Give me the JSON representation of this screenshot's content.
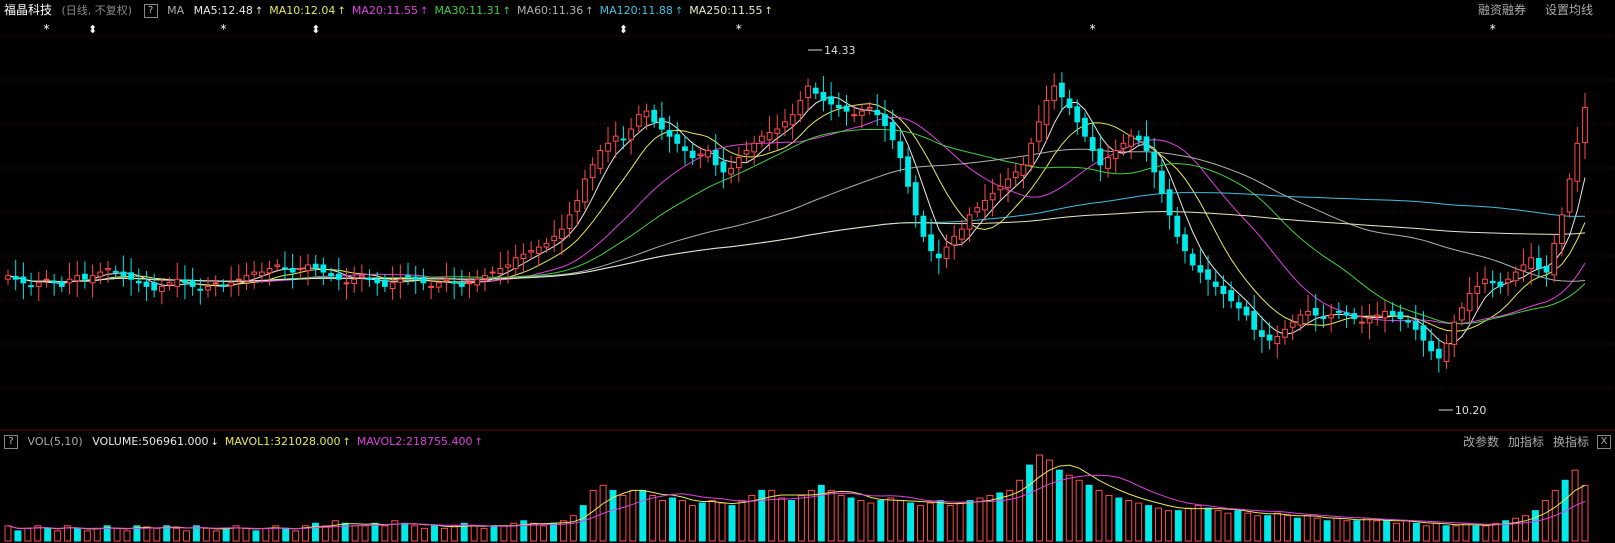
{
  "header": {
    "stock_name": "福晶科技",
    "period_label": "(日线, 不复权)",
    "help_label": "?",
    "indicator_name": "MA",
    "ma_items": [
      {
        "label": "MA5:12.48",
        "color": "#e8e8e8",
        "arrow": "↑"
      },
      {
        "label": "MA10:12.04",
        "color": "#e8e85a",
        "arrow": "↑"
      },
      {
        "label": "MA20:11.55",
        "color": "#e040e0",
        "arrow": "↑"
      },
      {
        "label": "MA30:11.31",
        "color": "#40d040",
        "arrow": "↑"
      },
      {
        "label": "MA60:11.36",
        "color": "#b0b0b0",
        "arrow": "↑"
      },
      {
        "label": "MA120:11.88",
        "color": "#40c0e0",
        "arrow": "↑"
      },
      {
        "label": "MA250:11.55",
        "color": "#e8e8c0",
        "arrow": "↑"
      }
    ],
    "right_buttons": [
      "融资融券",
      "设置均线"
    ]
  },
  "volume_header": {
    "help_label": "?",
    "indicator_name": "VOL(5,10)",
    "items": [
      {
        "label": "VOLUME:506961.000",
        "color": "#e8e8e8",
        "arrow": "↓"
      },
      {
        "label": "MAVOL1:321028.000",
        "color": "#e8e85a",
        "arrow": "↑"
      },
      {
        "label": "MAVOL2:218755.400",
        "color": "#e040e0",
        "arrow": "↑"
      }
    ],
    "right_buttons": [
      "改参数",
      "加指标",
      "换指标"
    ],
    "close_label": "X"
  },
  "colors": {
    "up": "#ff4a4a",
    "down": "#00e8e8",
    "grid": "#5a0a0a"
  },
  "chart_data": {
    "type": "candlestick",
    "price_range": [
      9.6,
      14.8
    ],
    "annotations": [
      {
        "label": "14.33",
        "type": "high"
      },
      {
        "label": "10.20",
        "type": "low"
      }
    ],
    "markers": {
      "star_label": "*",
      "arrow_label": "⬍",
      "stars": [
        5,
        28,
        95,
        141,
        193,
        236,
        264,
        361
      ],
      "arrows": [
        11,
        40,
        80,
        325,
        330
      ]
    },
    "closes": [
      11.45,
      11.4,
      11.35,
      11.3,
      11.35,
      11.4,
      11.35,
      11.3,
      11.4,
      11.45,
      11.4,
      11.45,
      11.5,
      11.55,
      11.5,
      11.45,
      11.4,
      11.35,
      11.3,
      11.25,
      11.3,
      11.35,
      11.4,
      11.35,
      11.3,
      11.25,
      11.3,
      11.35,
      11.3,
      11.35,
      11.4,
      11.45,
      11.5,
      11.5,
      11.55,
      11.6,
      11.55,
      11.5,
      11.55,
      11.6,
      11.55,
      11.5,
      11.45,
      11.4,
      11.35,
      11.4,
      11.45,
      11.4,
      11.35,
      11.3,
      11.35,
      11.4,
      11.45,
      11.4,
      11.35,
      11.3,
      11.35,
      11.4,
      11.35,
      11.3,
      11.35,
      11.4,
      11.45,
      11.5,
      11.55,
      11.6,
      11.7,
      11.75,
      11.8,
      11.85,
      11.9,
      12.0,
      12.1,
      12.3,
      12.5,
      12.8,
      13.0,
      13.2,
      13.3,
      13.4,
      13.35,
      13.5,
      13.7,
      13.75,
      13.6,
      13.5,
      13.4,
      13.3,
      13.2,
      13.1,
      13.15,
      13.2,
      13.0,
      12.9,
      12.95,
      13.1,
      13.2,
      13.3,
      13.4,
      13.45,
      13.5,
      13.6,
      13.7,
      13.9,
      14.1,
      14.0,
      13.9,
      13.85,
      13.8,
      13.75,
      13.7,
      13.75,
      13.8,
      13.7,
      13.55,
      13.35,
      13.1,
      12.7,
      12.3,
      12.0,
      11.8,
      11.7,
      11.85,
      12.0,
      12.1,
      12.3,
      12.4,
      12.5,
      12.6,
      12.7,
      12.8,
      12.9,
      13.0,
      13.3,
      13.6,
      13.9,
      14.1,
      13.95,
      13.8,
      13.6,
      13.4,
      13.2,
      13.0,
      13.1,
      13.2,
      13.3,
      13.4,
      13.35,
      13.2,
      12.9,
      12.6,
      12.3,
      12.0,
      11.8,
      11.6,
      11.5,
      11.4,
      11.3,
      11.2,
      11.1,
      11.0,
      10.9,
      10.7,
      10.6,
      10.55,
      10.6,
      10.7,
      10.8,
      10.9,
      10.95,
      10.9,
      10.85,
      10.9,
      10.95,
      10.9,
      10.85,
      10.8,
      10.85,
      10.9,
      10.95,
      10.9,
      10.85,
      10.8,
      10.7,
      10.55,
      10.4,
      10.3,
      10.5,
      10.8,
      11.0,
      11.2,
      11.3,
      11.4,
      11.35,
      11.3,
      11.4,
      11.5,
      11.6,
      11.7,
      11.55,
      11.5,
      11.9,
      12.3,
      12.8,
      13.3,
      13.8
    ],
    "volumes": [
      0.3,
      0.2,
      0.25,
      0.3,
      0.25,
      0.2,
      0.3,
      0.25,
      0.2,
      0.25,
      0.3,
      0.25,
      0.2,
      0.3,
      0.28,
      0.25,
      0.3,
      0.25,
      0.2,
      0.3,
      0.25,
      0.2,
      0.25,
      0.3,
      0.25,
      0.2,
      0.25,
      0.3,
      0.25,
      0.2,
      0.3,
      0.35,
      0.3,
      0.4,
      0.35,
      0.3,
      0.3,
      0.35,
      0.3,
      0.4,
      0.35,
      0.3,
      0.25,
      0.3,
      0.25,
      0.3,
      0.35,
      0.3,
      0.25,
      0.3,
      0.3,
      0.35,
      0.4,
      0.35,
      0.3,
      0.35,
      0.4,
      0.5,
      0.7,
      1.0,
      1.1,
      1.0,
      0.9,
      1.0,
      1.0,
      0.9,
      0.8,
      0.85,
      0.8,
      0.7,
      0.75,
      0.8,
      0.75,
      0.7,
      0.8,
      0.9,
      1.0,
      1.0,
      0.85,
      0.8,
      0.9,
      1.0,
      1.1,
      1.0,
      0.9,
      0.85,
      0.8,
      0.75,
      0.8,
      0.85,
      0.8,
      0.75,
      0.7,
      0.75,
      0.8,
      0.7,
      0.75,
      0.8,
      0.85,
      0.9,
      0.95,
      1.0,
      1.2,
      1.5,
      1.7,
      1.6,
      1.4,
      1.3,
      1.2,
      1.1,
      1.0,
      0.9,
      0.85,
      0.8,
      0.75,
      0.7,
      0.65,
      0.6,
      0.6,
      0.65,
      0.7,
      0.65,
      0.6,
      0.55,
      0.6,
      0.55,
      0.5,
      0.5,
      0.55,
      0.5,
      0.45,
      0.5,
      0.45,
      0.4,
      0.45,
      0.4,
      0.4,
      0.45,
      0.4,
      0.4,
      0.35,
      0.4,
      0.35,
      0.3,
      0.35,
      0.3,
      0.3,
      0.35,
      0.3,
      0.3,
      0.35,
      0.4,
      0.45,
      0.5,
      0.6,
      0.8,
      1.0,
      1.2,
      1.4,
      1.1
    ]
  }
}
